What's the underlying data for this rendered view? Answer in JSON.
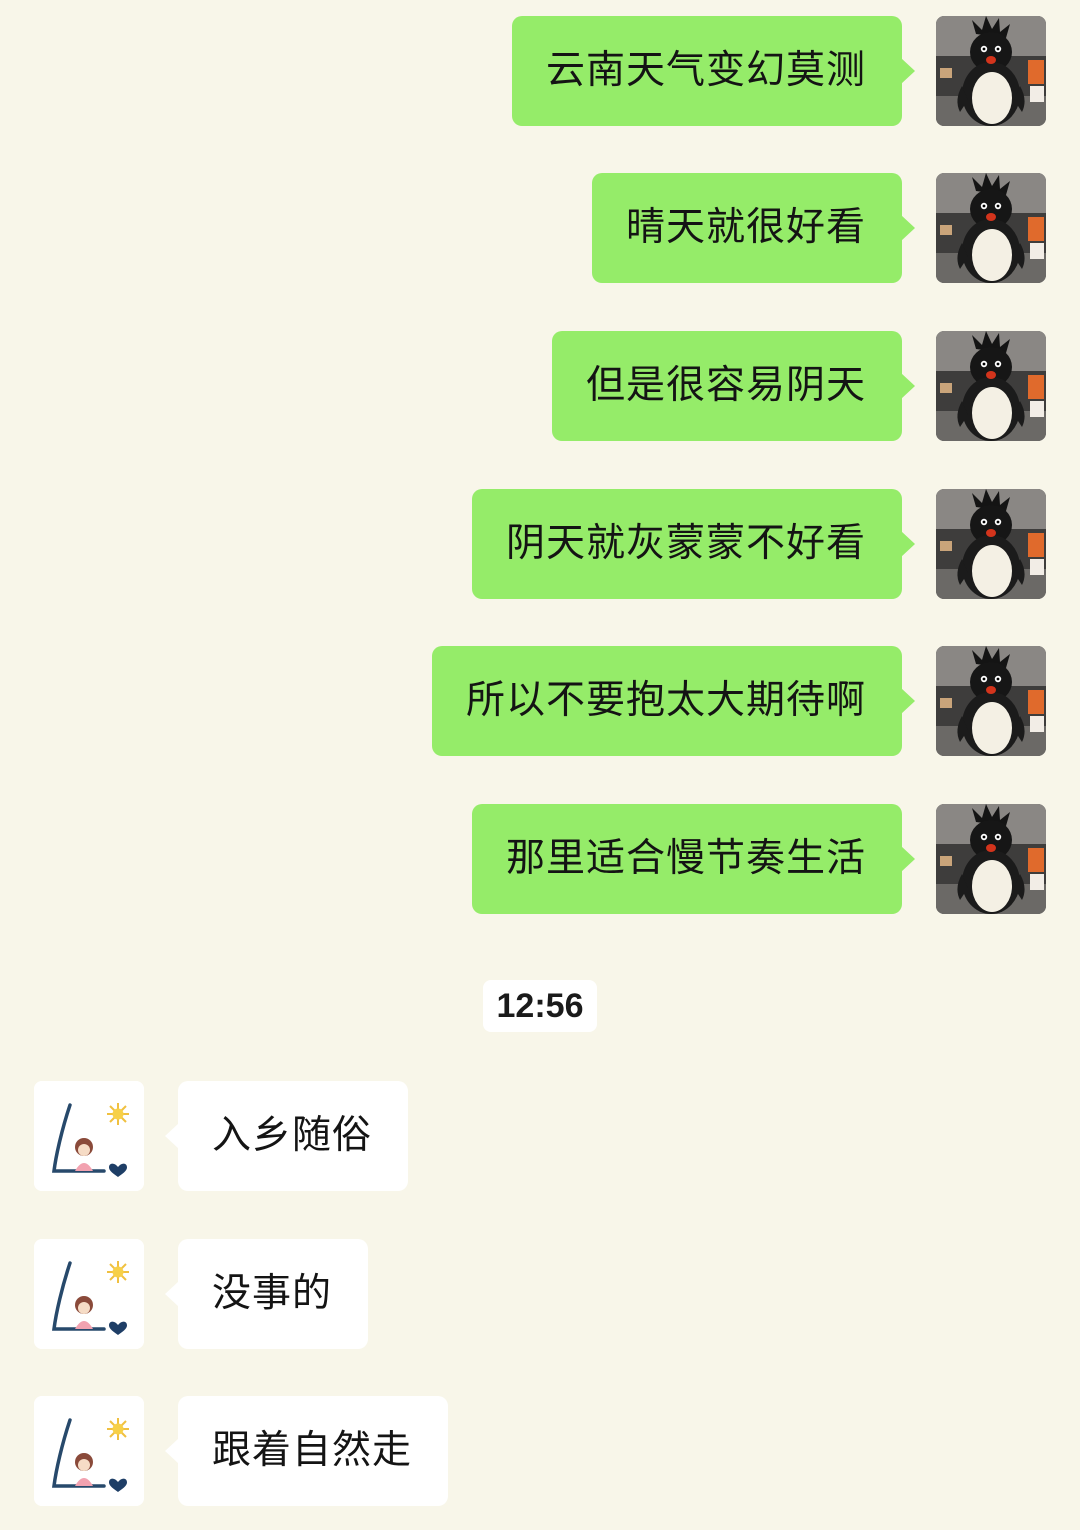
{
  "outgoing_messages": [
    {
      "text": "云南天气变幻莫测"
    },
    {
      "text": "晴天就很好看"
    },
    {
      "text": "但是很容易阴天"
    },
    {
      "text": "阴天就灰蒙蒙不好看"
    },
    {
      "text": "所以不要抱太大期待啊"
    },
    {
      "text": "那里适合慢节奏生活"
    }
  ],
  "timestamp": "12:56",
  "incoming_messages": [
    {
      "text": "入乡随俗"
    },
    {
      "text": "没事的"
    },
    {
      "text": "跟着自然走"
    }
  ],
  "colors": {
    "background": "#f8f6e9",
    "outgoing_bubble": "#95ec69",
    "incoming_bubble": "#ffffff"
  },
  "icons": {
    "my_avatar": "penguin-plush-avatar-icon",
    "contact_avatar": "cartoon-girl-sun-heart-avatar-icon"
  }
}
